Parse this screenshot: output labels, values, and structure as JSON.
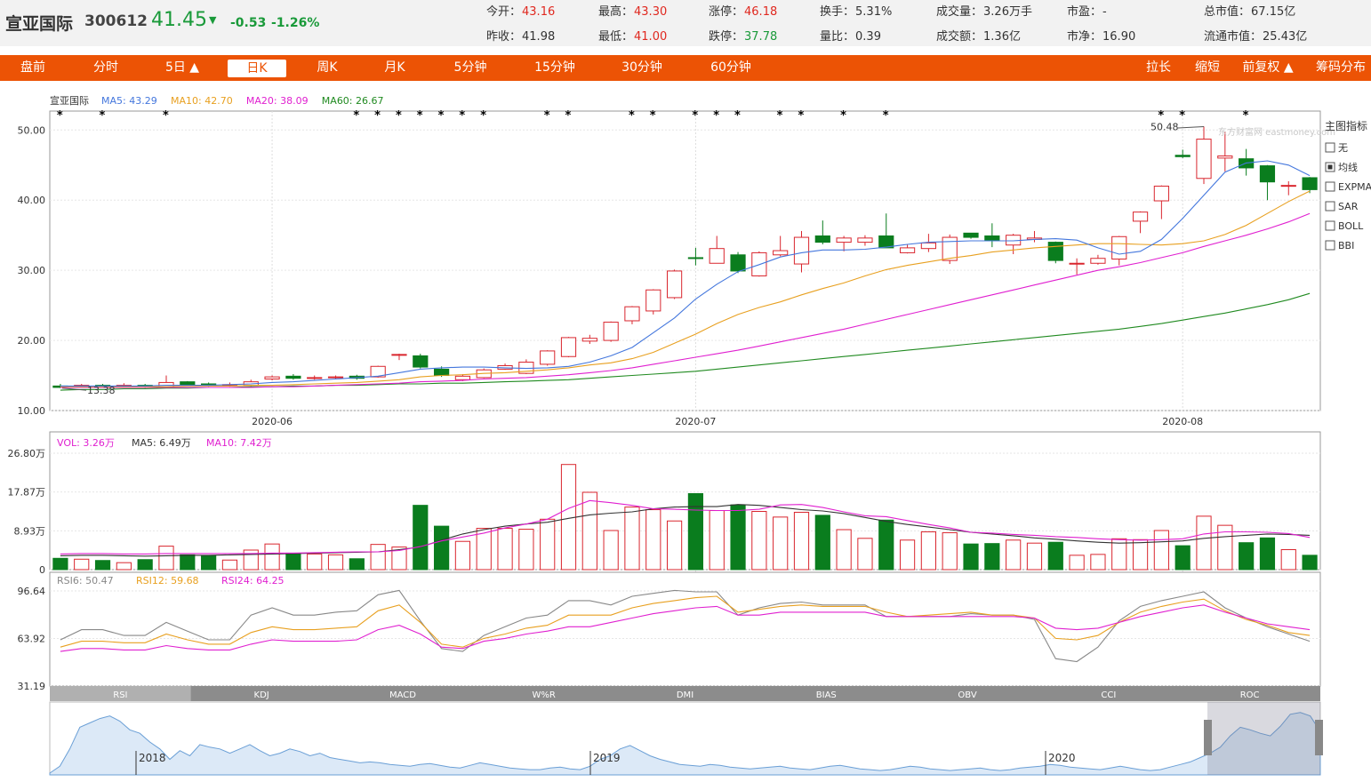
{
  "header": {
    "name": "宣亚国际",
    "code": "300612",
    "price": "41.45",
    "arrow": "▼",
    "change": "-0.53",
    "change_pct": "-1.26%",
    "quotes": [
      {
        "label": "今开：",
        "value": "43.16",
        "color": "red",
        "col": 0,
        "row": 0
      },
      {
        "label": "昨收：",
        "value": "41.98",
        "color": "dark",
        "col": 0,
        "row": 1
      },
      {
        "label": "最高：",
        "value": "43.30",
        "color": "red",
        "col": 1,
        "row": 0
      },
      {
        "label": "最低：",
        "value": "41.00",
        "color": "red",
        "col": 1,
        "row": 1
      },
      {
        "label": "涨停：",
        "value": "46.18",
        "color": "red",
        "col": 2,
        "row": 0
      },
      {
        "label": "跌停：",
        "value": "37.78",
        "color": "green",
        "col": 2,
        "row": 1
      },
      {
        "label": "换手：",
        "value": "5.31%",
        "color": "dark",
        "col": 3,
        "row": 0
      },
      {
        "label": "量比：",
        "value": "0.39",
        "color": "dark",
        "col": 3,
        "row": 1
      },
      {
        "label": "成交量：",
        "value": "3.26万手",
        "color": "dark",
        "col": 4,
        "row": 0
      },
      {
        "label": "成交额：",
        "value": "1.36亿",
        "color": "dark",
        "col": 4,
        "row": 1
      },
      {
        "label": "市盈：",
        "value": "-",
        "color": "dark",
        "col": 5,
        "row": 0
      },
      {
        "label": "市净：",
        "value": "16.90",
        "color": "dark",
        "col": 5,
        "row": 1
      },
      {
        "label": "总市值：",
        "value": "67.15亿",
        "color": "dark",
        "col": 6,
        "row": 0
      },
      {
        "label": "流通市值：",
        "value": "25.43亿",
        "color": "dark",
        "col": 6,
        "row": 1
      }
    ]
  },
  "nav": {
    "left": [
      "盘前",
      "分时",
      "5日 ▲",
      "日K",
      "周K",
      "月K",
      "5分钟",
      "15分钟",
      "30分钟",
      "60分钟"
    ],
    "active": "日K",
    "right": [
      "拉长",
      "缩短",
      "前复权 ▲",
      "筹码分布"
    ]
  },
  "indicators": {
    "title": "主图指标",
    "items": [
      {
        "label": "无",
        "checked": false
      },
      {
        "label": "均线",
        "checked": true
      },
      {
        "label": "EXPMA",
        "checked": false
      },
      {
        "label": "SAR",
        "checked": false
      },
      {
        "label": "BOLL",
        "checked": false
      },
      {
        "label": "BBI",
        "checked": false
      }
    ]
  },
  "bottom_tabs": [
    "RSI",
    "KDJ",
    "MACD",
    "W%R",
    "DMI",
    "BIAS",
    "OBV",
    "CCI",
    "ROC"
  ],
  "active_tab": "RSI",
  "watermark": "东方财富网 eastmoney.com",
  "colors": {
    "up": "#d9262e",
    "down": "#0a7d1e",
    "ma5": "#4477dd",
    "ma10": "#e8a020",
    "ma20": "#e020d0",
    "ma60": "#208a20",
    "accent": "#ec5305"
  },
  "chart_data": [
    {
      "type": "candlestick",
      "legend": [
        {
          "text": "宣亚国际",
          "color": "#333333"
        },
        {
          "text": "MA5: 43.29",
          "color": "#4477dd"
        },
        {
          "text": "MA10: 42.70",
          "color": "#e8a020"
        },
        {
          "text": "MA20: 38.09",
          "color": "#e020d0"
        },
        {
          "text": "MA60: 26.67",
          "color": "#208a20"
        }
      ],
      "y_ticks": [
        "50.00",
        "40.00",
        "30.00",
        "20.00",
        "10.00"
      ],
      "ylim": [
        10,
        52.7
      ],
      "x_labels": [
        {
          "i": 10,
          "text": "2020-06"
        },
        {
          "i": 30,
          "text": "2020-07"
        },
        {
          "i": 53,
          "text": "2020-08"
        }
      ],
      "annotations": {
        "high": "50.48",
        "low": "13.38"
      },
      "candles": [
        [
          13.5,
          13.3,
          13.8,
          13.2
        ],
        [
          13.4,
          13.6,
          13.8,
          13.3
        ],
        [
          13.6,
          13.5,
          13.8,
          13.3
        ],
        [
          13.5,
          13.6,
          13.9,
          13.3
        ],
        [
          13.6,
          13.3,
          13.8,
          13.2
        ],
        [
          13.3,
          14.0,
          15.0,
          13.2
        ],
        [
          14.1,
          13.7,
          14.2,
          13.5
        ],
        [
          13.8,
          13.6,
          14.0,
          13.4
        ],
        [
          13.6,
          13.7,
          14.0,
          13.4
        ],
        [
          13.6,
          14.1,
          14.4,
          13.5
        ],
        [
          14.5,
          14.8,
          15.0,
          14.3
        ],
        [
          14.9,
          14.6,
          15.2,
          14.4
        ],
        [
          14.6,
          14.7,
          15.0,
          14.4
        ],
        [
          14.7,
          14.8,
          15.0,
          14.5
        ],
        [
          14.9,
          14.6,
          15.1,
          14.4
        ],
        [
          14.8,
          16.3,
          16.4,
          14.7
        ],
        [
          18.0,
          18.0,
          18.1,
          17.2
        ],
        [
          17.8,
          16.2,
          18.1,
          16.0
        ],
        [
          15.9,
          15.0,
          16.3,
          14.8
        ],
        [
          14.4,
          14.9,
          15.2,
          14.2
        ],
        [
          14.7,
          15.8,
          16.0,
          14.6
        ],
        [
          15.9,
          16.4,
          16.7,
          15.8
        ],
        [
          15.3,
          16.9,
          17.3,
          15.2
        ],
        [
          16.6,
          18.5,
          18.6,
          16.4
        ],
        [
          17.7,
          20.4,
          20.5,
          17.6
        ],
        [
          19.9,
          20.3,
          20.8,
          19.5
        ],
        [
          20.0,
          22.6,
          22.7,
          19.8
        ],
        [
          22.8,
          24.8,
          24.9,
          22.3
        ],
        [
          24.2,
          27.2,
          27.3,
          23.7
        ],
        [
          26.1,
          29.9,
          30.1,
          25.9
        ],
        [
          31.8,
          31.7,
          33.2,
          30.7
        ],
        [
          31.0,
          33.1,
          34.9,
          31.0
        ],
        [
          32.2,
          29.9,
          32.6,
          29.6
        ],
        [
          29.2,
          32.5,
          32.7,
          29.1
        ],
        [
          32.2,
          32.8,
          34.9,
          32.0
        ],
        [
          30.9,
          34.7,
          35.6,
          29.7
        ],
        [
          34.9,
          34.0,
          37.1,
          33.7
        ],
        [
          34.0,
          34.6,
          34.9,
          32.7
        ],
        [
          34.0,
          34.6,
          35.0,
          33.5
        ],
        [
          34.9,
          33.2,
          38.1,
          33.2
        ],
        [
          32.5,
          33.2,
          33.7,
          32.4
        ],
        [
          33.1,
          33.9,
          35.2,
          32.6
        ],
        [
          31.4,
          34.7,
          35.1,
          30.9
        ],
        [
          35.3,
          34.7,
          35.3,
          34.5
        ],
        [
          34.9,
          34.2,
          36.7,
          33.3
        ],
        [
          33.6,
          35.0,
          35.2,
          32.3
        ],
        [
          34.4,
          34.6,
          35.6,
          34.0
        ],
        [
          34.0,
          31.4,
          34.1,
          31.0
        ],
        [
          31.0,
          31.0,
          31.7,
          29.4
        ],
        [
          31.0,
          31.7,
          32.2,
          30.8
        ],
        [
          31.6,
          34.8,
          34.9,
          30.7
        ],
        [
          37.0,
          38.3,
          38.4,
          35.3
        ],
        [
          39.9,
          42.0,
          42.1,
          37.3
        ],
        [
          46.4,
          46.2,
          47.2,
          46.0
        ],
        [
          43.1,
          48.7,
          50.5,
          42.3
        ],
        [
          46.0,
          46.3,
          49.7,
          44.1
        ],
        [
          45.9,
          44.6,
          47.3,
          43.5
        ],
        [
          44.9,
          42.6,
          45.0,
          40.0
        ],
        [
          42.1,
          42.1,
          42.7,
          40.7
        ],
        [
          43.2,
          41.5,
          43.3,
          41.0
        ]
      ],
      "ma5": [
        13.5,
        13.5,
        13.5,
        13.5,
        13.5,
        13.6,
        13.6,
        13.6,
        13.7,
        13.8,
        14.0,
        14.1,
        14.3,
        14.5,
        14.7,
        14.9,
        15.4,
        15.9,
        16.1,
        16.2,
        16.2,
        16.1,
        16.0,
        16.1,
        16.3,
        16.9,
        17.8,
        19.0,
        21.1,
        23.2,
        25.9,
        28.0,
        29.8,
        30.8,
        31.9,
        32.5,
        32.9,
        32.9,
        33.0,
        33.3,
        33.7,
        34.0,
        34.1,
        34.2,
        34.2,
        34.2,
        34.4,
        34.5,
        34.3,
        33.2,
        32.3,
        32.7,
        34.4,
        37.4,
        40.7,
        44.0,
        45.3,
        45.6,
        45.0,
        43.5
      ],
      "ma10": [
        13.4,
        13.4,
        13.4,
        13.4,
        13.4,
        13.4,
        13.5,
        13.5,
        13.5,
        13.6,
        13.6,
        13.7,
        13.8,
        13.9,
        14.0,
        14.2,
        14.4,
        14.8,
        15.0,
        15.1,
        15.3,
        15.4,
        15.6,
        15.8,
        16.1,
        16.5,
        16.8,
        17.4,
        18.3,
        19.6,
        20.9,
        22.4,
        23.7,
        24.7,
        25.5,
        26.5,
        27.4,
        28.2,
        29.2,
        30.1,
        30.7,
        31.2,
        31.7,
        32.1,
        32.6,
        32.9,
        33.2,
        33.4,
        33.6,
        33.8,
        33.8,
        33.7,
        33.6,
        33.8,
        34.2,
        35.1,
        36.4,
        38.1,
        39.8,
        41.3
      ],
      "ma20": [
        13.3,
        13.3,
        13.3,
        13.3,
        13.3,
        13.3,
        13.3,
        13.3,
        13.3,
        13.3,
        13.4,
        13.4,
        13.5,
        13.6,
        13.7,
        13.8,
        13.9,
        14.1,
        14.2,
        14.3,
        14.5,
        14.6,
        14.7,
        14.9,
        15.1,
        15.4,
        15.7,
        16.1,
        16.6,
        17.1,
        17.6,
        18.1,
        18.6,
        19.2,
        19.8,
        20.4,
        21.0,
        21.6,
        22.3,
        23.0,
        23.7,
        24.4,
        25.1,
        25.8,
        26.5,
        27.2,
        27.9,
        28.6,
        29.3,
        30.0,
        30.5,
        31.1,
        31.8,
        32.5,
        33.4,
        34.2,
        35.0,
        35.9,
        36.9,
        38.1
      ],
      "ma60": [
        12.9,
        13.0,
        13.0,
        13.1,
        13.1,
        13.2,
        13.2,
        13.3,
        13.3,
        13.4,
        13.4,
        13.5,
        13.5,
        13.6,
        13.6,
        13.7,
        13.8,
        13.8,
        13.9,
        13.9,
        14.0,
        14.1,
        14.2,
        14.3,
        14.4,
        14.6,
        14.8,
        15.0,
        15.2,
        15.4,
        15.6,
        15.9,
        16.2,
        16.5,
        16.8,
        17.1,
        17.4,
        17.7,
        18.0,
        18.3,
        18.6,
        18.9,
        19.2,
        19.5,
        19.8,
        20.1,
        20.4,
        20.7,
        21.0,
        21.3,
        21.6,
        22.0,
        22.4,
        22.9,
        23.4,
        23.9,
        24.5,
        25.1,
        25.8,
        26.7
      ]
    },
    {
      "type": "bar",
      "legend": [
        {
          "text": "VOL: 3.26万",
          "color": "#e020d0"
        },
        {
          "text": "MA5: 6.49万",
          "color": "#333333"
        },
        {
          "text": "MA10: 7.42万",
          "color": "#e020d0"
        }
      ],
      "y_ticks": [
        {
          "v": 26.8,
          "text": "26.80万"
        },
        {
          "v": 17.87,
          "text": "17.87万"
        },
        {
          "v": 8.93,
          "text": "8.93万"
        },
        {
          "v": 0,
          "text": "0"
        }
      ],
      "ylim": [
        0,
        26.8
      ],
      "values": [
        2.6,
        2.4,
        2.1,
        1.6,
        2.3,
        5.4,
        3.4,
        3.2,
        2.2,
        4.5,
        5.9,
        3.8,
        3.6,
        3.4,
        2.5,
        5.8,
        5.2,
        14.8,
        10.0,
        6.5,
        9.5,
        9.5,
        9.3,
        11.6,
        24.2,
        17.8,
        9.0,
        14.4,
        13.8,
        11.2,
        17.5,
        13.6,
        14.9,
        13.4,
        12.1,
        13.2,
        12.5,
        9.2,
        7.2,
        11.4,
        6.8,
        8.7,
        8.5,
        5.9,
        6.0,
        6.8,
        6.1,
        6.3,
        3.3,
        3.5,
        7.1,
        6.9,
        9.0,
        5.5,
        12.3,
        10.2,
        6.2,
        7.3,
        4.6,
        3.3
      ],
      "ma5": [
        3.2,
        3.3,
        3.3,
        3.2,
        3.1,
        3.2,
        3.3,
        3.3,
        3.4,
        3.5,
        3.6,
        3.7,
        3.8,
        3.9,
        4.0,
        4.1,
        4.6,
        5.2,
        6.8,
        8.2,
        9.2,
        10.0,
        10.5,
        10.9,
        11.8,
        12.6,
        13.0,
        13.3,
        14.0,
        14.4,
        14.5,
        14.5,
        15.0,
        14.8,
        14.3,
        13.8,
        13.5,
        12.9,
        12.0,
        11.1,
        10.4,
        9.8,
        9.2,
        8.6,
        8.2,
        7.8,
        7.3,
        7.0,
        6.6,
        6.3,
        6.1,
        6.2,
        6.4,
        6.6,
        7.2,
        7.6,
        7.9,
        8.2,
        8.1,
        7.9
      ],
      "ma10": [
        3.6,
        3.7,
        3.7,
        3.6,
        3.6,
        3.7,
        3.7,
        3.7,
        3.7,
        3.7,
        3.8,
        3.8,
        3.9,
        4.0,
        4.1,
        4.1,
        4.4,
        5.3,
        6.6,
        7.5,
        8.4,
        9.6,
        10.5,
        11.6,
        14.1,
        15.9,
        15.4,
        14.8,
        14.0,
        13.9,
        13.7,
        13.6,
        13.6,
        13.9,
        14.9,
        15.0,
        14.3,
        13.3,
        12.4,
        12.2,
        11.3,
        10.4,
        9.6,
        8.6,
        8.4,
        8.1,
        7.9,
        7.6,
        7.4,
        7.1,
        6.9,
        6.8,
        6.9,
        7.1,
        8.2,
        8.7,
        8.7,
        8.6,
        8.3,
        7.4
      ]
    },
    {
      "type": "line",
      "legend": [
        {
          "text": "RSI6: 50.47",
          "color": "#888888"
        },
        {
          "text": "RSI12: 59.68",
          "color": "#e8a020"
        },
        {
          "text": "RSI24: 64.25",
          "color": "#e020d0"
        }
      ],
      "y_ticks": [
        "96.64",
        "63.92",
        "31.19"
      ],
      "ylim": [
        31.19,
        96.64
      ],
      "rsi6": [
        63,
        70,
        70,
        66,
        66,
        75,
        69,
        63,
        63,
        80,
        85,
        80,
        80,
        82,
        83,
        94,
        97,
        76,
        57,
        55,
        66,
        72,
        78,
        80,
        90,
        90,
        87,
        93,
        95,
        97,
        96,
        96,
        80,
        85,
        88,
        89,
        87,
        87,
        87,
        79,
        79,
        79,
        79,
        81,
        80,
        80,
        77,
        50,
        48,
        58,
        76,
        86,
        90,
        93,
        96,
        85,
        78,
        72,
        67,
        62
      ],
      "rsi12": [
        58,
        62,
        62,
        61,
        61,
        67,
        63,
        60,
        60,
        68,
        72,
        70,
        70,
        71,
        72,
        83,
        87,
        75,
        60,
        58,
        64,
        67,
        71,
        73,
        80,
        80,
        80,
        85,
        88,
        90,
        92,
        93,
        82,
        84,
        86,
        87,
        86,
        86,
        86,
        82,
        79,
        80,
        81,
        82,
        80,
        80,
        78,
        64,
        63,
        66,
        75,
        82,
        86,
        89,
        91,
        83,
        77,
        73,
        68,
        66
      ],
      "rsi24": [
        55,
        57,
        57,
        56,
        56,
        59,
        57,
        56,
        56,
        60,
        63,
        62,
        62,
        62,
        63,
        70,
        73,
        67,
        58,
        57,
        62,
        64,
        67,
        69,
        72,
        72,
        75,
        78,
        81,
        83,
        85,
        86,
        80,
        80,
        82,
        82,
        82,
        82,
        82,
        79,
        79,
        79,
        79,
        79,
        79,
        79,
        78,
        71,
        70,
        71,
        75,
        79,
        82,
        85,
        87,
        82,
        78,
        74,
        72,
        70
      ]
    },
    {
      "type": "area",
      "x_labels": [
        "2018",
        "2019",
        "2020"
      ],
      "values": [
        2,
        10,
        30,
        55,
        60,
        65,
        68,
        62,
        52,
        48,
        38,
        30,
        18,
        28,
        22,
        35,
        32,
        30,
        25,
        30,
        35,
        28,
        22,
        25,
        30,
        27,
        22,
        25,
        20,
        18,
        16,
        14,
        15,
        14,
        12,
        11,
        10,
        12,
        13,
        11,
        9,
        8,
        11,
        14,
        12,
        10,
        8,
        7,
        6,
        6,
        8,
        9,
        7,
        6,
        10,
        18,
        22,
        30,
        34,
        28,
        22,
        18,
        15,
        12,
        11,
        10,
        12,
        11,
        9,
        8,
        7,
        8,
        9,
        10,
        8,
        7,
        6,
        8,
        10,
        11,
        9,
        7,
        6,
        5,
        6,
        8,
        10,
        9,
        7,
        6,
        5,
        6,
        7,
        8,
        6,
        5,
        6,
        8,
        9,
        10,
        12,
        11,
        9,
        8,
        7,
        6,
        8,
        10,
        8,
        6,
        5,
        6,
        9,
        12,
        15,
        20,
        25,
        32,
        45,
        55,
        52,
        48,
        45,
        56,
        70,
        72,
        68,
        50
      ]
    }
  ]
}
